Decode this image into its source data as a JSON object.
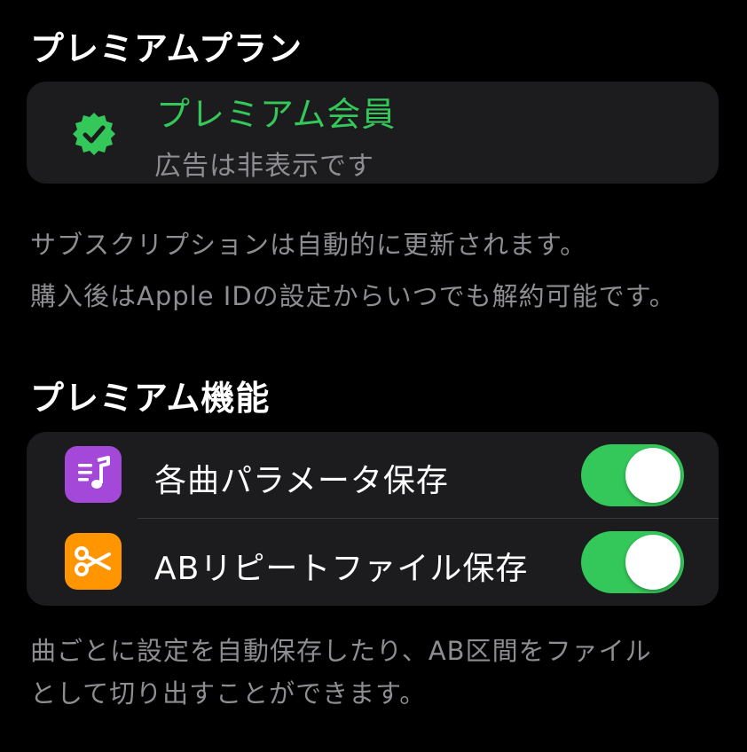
{
  "sections": {
    "premium_plan_title": "プレミアムプラン",
    "premium_features_title": "プレミアム機能"
  },
  "premium_card": {
    "title": "プレミアム会員",
    "subtitle": "広告は非表示です",
    "icon": "checkmark-seal-icon"
  },
  "subscription_notes": {
    "line1": "サブスクリプションは自動的に更新されます。",
    "line2": "購入後はApple IDの設定からいつでも解約可能です。"
  },
  "features": [
    {
      "label": "各曲パラメータ保存",
      "icon": "music-list-icon",
      "enabled": true
    },
    {
      "label": "ABリピートファイル保存",
      "icon": "scissors-icon",
      "enabled": true
    }
  ],
  "features_note": {
    "line1": "曲ごとに設定を自動保存したり、AB区間をファイル",
    "line2": "として切り出すことができます。"
  },
  "colors": {
    "background": "#000000",
    "card": "#1c1c1e",
    "accent_green": "#34c759",
    "secondary_text": "#8d8d92",
    "music_icon_bg": "#a348d8",
    "scissors_icon_bg": "#ff9500"
  }
}
